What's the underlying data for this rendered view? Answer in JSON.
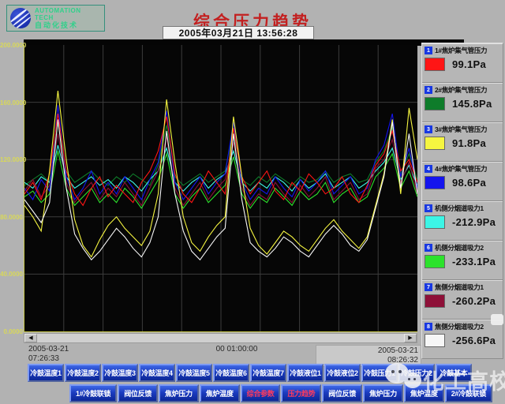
{
  "header": {
    "logo_line1": "AUTOMATION TECH",
    "logo_line2": "自动化技术",
    "title": "综合压力趋势",
    "datetime": "2005年03月21日  13:56:28"
  },
  "chart": {
    "y_labels": [
      "200.0000",
      "160.0000",
      "120.0000",
      "80.0000",
      "40.0000",
      "0.0000"
    ],
    "x_start_date": "2005-03-21",
    "x_start_time": "07:26:33",
    "x_span_label": "00 01:00:00",
    "x_end_date": "2005-03-21",
    "x_end_time": "08:26:32"
  },
  "scrollbar": {
    "left_arrow": "◀",
    "right_arrow": "▶"
  },
  "chart_data": {
    "type": "line",
    "title": "综合压力趋势",
    "x_range": [
      "2005-03-21 07:26:33",
      "2005-03-21 08:26:32"
    ],
    "x_interval_label": "00 01:00:00",
    "ylim": [
      0,
      200
    ],
    "y_ticks": [
      0,
      40,
      80,
      120,
      160,
      200
    ],
    "grid": true,
    "legend_position": "right",
    "series": [
      {
        "name": "1#焦炉集气管压力",
        "color": "#ff1515",
        "current_value": "99.1Pa",
        "display_values": [
          96,
          104,
          92,
          110,
          152,
          112,
          96,
          88,
          100,
          108,
          94,
          102,
          96,
          90,
          104,
          112,
          126,
          150,
          110,
          96,
          90,
          100,
          112,
          104,
          96,
          142,
          108,
          96,
          104,
          112,
          98,
          92,
          104,
          98,
          110,
          104,
          96,
          100,
          108,
          96,
          90,
          102,
          116,
          124,
          140,
          112,
          120,
          104
        ]
      },
      {
        "name": "2#焦炉集气管压力",
        "color": "#0e7c2a",
        "current_value": "145.8Pa",
        "display_values": [
          102,
          106,
          110,
          104,
          146,
          112,
          104,
          108,
          112,
          106,
          102,
          108,
          104,
          110,
          106,
          102,
          116,
          144,
          108,
          102,
          106,
          110,
          104,
          108,
          112,
          140,
          106,
          102,
          108,
          104,
          110,
          106,
          102,
          108,
          104,
          106,
          112,
          104,
          108,
          110,
          104,
          106,
          118,
          126,
          142,
          110,
          124,
          106
        ]
      },
      {
        "name": "3#焦炉集气管压力",
        "color": "#f5f540",
        "current_value": "91.8Pa",
        "display_values": [
          88,
          80,
          70,
          112,
          168,
          120,
          78,
          60,
          52,
          64,
          74,
          80,
          72,
          66,
          60,
          70,
          96,
          162,
          118,
          80,
          62,
          56,
          66,
          74,
          80,
          150,
          108,
          72,
          60,
          54,
          62,
          70,
          66,
          60,
          56,
          64,
          72,
          78,
          70,
          64,
          58,
          66,
          88,
          110,
          148,
          96,
          156,
          120
        ]
      },
      {
        "name": "4#焦炉集气管压力",
        "color": "#1414ee",
        "current_value": "98.6Pa",
        "display_values": [
          100,
          92,
          106,
          98,
          158,
          108,
          92,
          100,
          112,
          96,
          104,
          96,
          108,
          100,
          92,
          106,
          118,
          154,
          104,
          92,
          100,
          108,
          96,
          104,
          110,
          146,
          104,
          92,
          100,
          96,
          108,
          100,
          94,
          106,
          98,
          104,
          112,
          96,
          102,
          108,
          96,
          100,
          120,
          130,
          152,
          108,
          128,
          100
        ]
      },
      {
        "name": "机侧分烟道吸力1",
        "color": "#3cf5e6",
        "current_value": "-212.9Pa",
        "display_values": [
          104,
          100,
          108,
          104,
          130,
          108,
          100,
          104,
          108,
          102,
          106,
          100,
          108,
          104,
          98,
          106,
          112,
          128,
          104,
          98,
          104,
          108,
          100,
          106,
          110,
          126,
          104,
          98,
          104,
          100,
          108,
          104,
          98,
          106,
          100,
          104,
          110,
          100,
          104,
          108,
          100,
          104,
          112,
          118,
          128,
          106,
          116,
          102
        ]
      },
      {
        "name": "机侧分烟道吸力2",
        "color": "#2ce22c",
        "current_value": "-233.1Pa",
        "display_values": [
          94,
          98,
          90,
          96,
          126,
          100,
          88,
          94,
          100,
          90,
          96,
          90,
          100,
          94,
          86,
          96,
          106,
          124,
          96,
          86,
          94,
          100,
          90,
          96,
          102,
          122,
          96,
          86,
          94,
          90,
          100,
          94,
          88,
          98,
          92,
          96,
          104,
          90,
          96,
          100,
          90,
          94,
          108,
          114,
          124,
          100,
          112,
          94
        ]
      },
      {
        "name": "焦侧分烟道吸力1",
        "color": "#8e1038",
        "current_value": "-260.2Pa",
        "display_values": [
          98,
          106,
          94,
          102,
          138,
          104,
          90,
          98,
          104,
          92,
          100,
          94,
          104,
          96,
          88,
          100,
          112,
          136,
          100,
          88,
          96,
          104,
          92,
          100,
          106,
          132,
          100,
          88,
          96,
          92,
          104,
          96,
          90,
          102,
          94,
          100,
          108,
          92,
          98,
          104,
          92,
          96,
          114,
          120,
          134,
          104,
          118,
          96
        ]
      },
      {
        "name": "焦侧分烟道吸力2",
        "color": "#f6f6f6",
        "current_value": "-256.6Pa",
        "display_values": [
          92,
          84,
          76,
          90,
          148,
          100,
          68,
          58,
          50,
          56,
          64,
          72,
          66,
          58,
          52,
          62,
          80,
          140,
          96,
          70,
          56,
          50,
          58,
          66,
          72,
          138,
          92,
          62,
          56,
          52,
          58,
          66,
          62,
          56,
          52,
          60,
          68,
          74,
          68,
          60,
          56,
          64,
          86,
          108,
          146,
          100,
          138,
          96
        ]
      }
    ]
  },
  "legend": {
    "items": [
      {
        "num": "1",
        "label": "1#焦炉集气管压力",
        "color": "#ff1515",
        "value": "99.1Pa"
      },
      {
        "num": "2",
        "label": "2#焦炉集气管压力",
        "color": "#0e7c2a",
        "value": "145.8Pa"
      },
      {
        "num": "3",
        "label": "3#焦炉集气管压力",
        "color": "#f5f540",
        "value": "91.8Pa"
      },
      {
        "num": "4",
        "label": "4#焦炉集气管压力",
        "color": "#1414ee",
        "value": "98.6Pa"
      },
      {
        "num": "5",
        "label": "机侧分烟道吸力1",
        "color": "#3cf5e6",
        "value": "-212.9Pa"
      },
      {
        "num": "6",
        "label": "机侧分烟道吸力2",
        "color": "#2ce22c",
        "value": "-233.1Pa"
      },
      {
        "num": "7",
        "label": "焦侧分烟道吸力1",
        "color": "#8e1038",
        "value": "-260.2Pa"
      },
      {
        "num": "8",
        "label": "焦侧分烟道吸力2",
        "color": "#f6f6f6",
        "value": "-256.6Pa"
      }
    ]
  },
  "buttons_row1": [
    {
      "label": "冷鼓温度1"
    },
    {
      "label": "冷鼓温度2"
    },
    {
      "label": "冷鼓温度3"
    },
    {
      "label": "冷鼓温度4"
    },
    {
      "label": "冷鼓温度5"
    },
    {
      "label": "冷鼓温度6"
    },
    {
      "label": "冷鼓温度7"
    },
    {
      "label": "冷鼓液位1"
    },
    {
      "label": "冷鼓液位2"
    },
    {
      "label": "冷鼓压力1"
    },
    {
      "label": "冷鼓压力2"
    },
    {
      "label": "冷鼓基本"
    }
  ],
  "buttons_row2": [
    {
      "label": "1#冷鼓联锁",
      "active": false
    },
    {
      "label": "阀位反馈",
      "active": false
    },
    {
      "label": "焦炉压力",
      "active": false
    },
    {
      "label": "焦炉温度",
      "active": false
    },
    {
      "label": "综合参数",
      "active": true
    },
    {
      "label": "压力趋势",
      "active": true
    },
    {
      "label": "阀位反馈",
      "active": false
    },
    {
      "label": "焦炉压力",
      "active": false
    },
    {
      "label": "焦炉温度",
      "active": false
    },
    {
      "label": "2#冷鼓联锁",
      "active": false
    }
  ],
  "watermark": {
    "text": "化工高校"
  }
}
